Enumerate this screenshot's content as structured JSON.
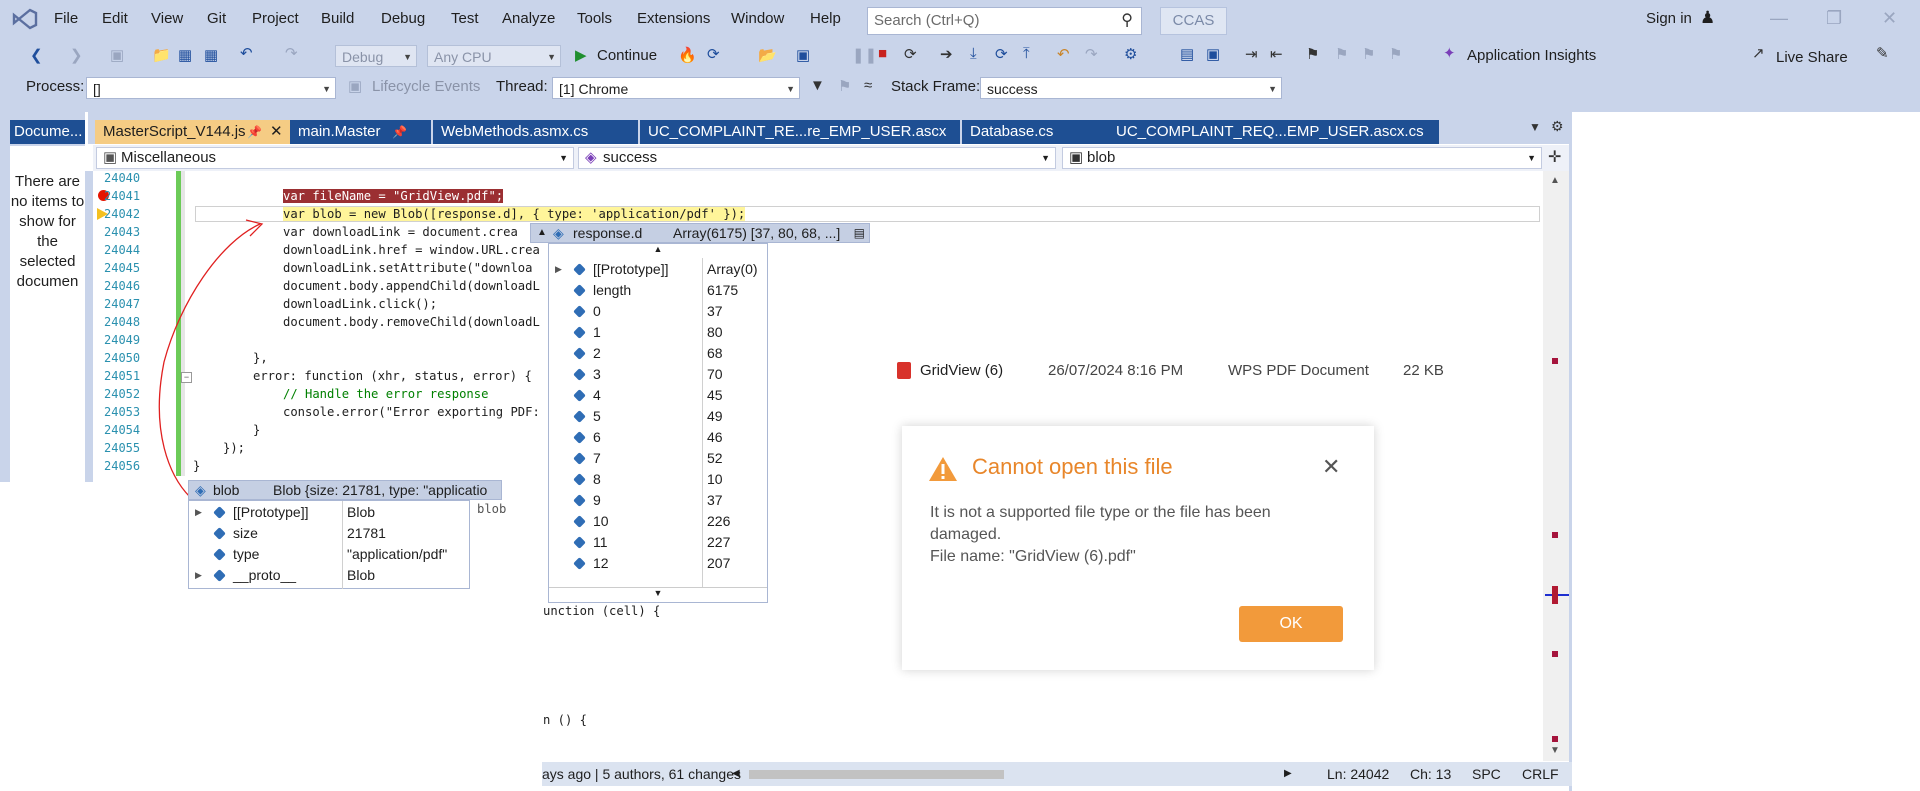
{
  "menu": {
    "items": [
      "File",
      "Edit",
      "View",
      "Git",
      "Project",
      "Build",
      "Debug",
      "Test",
      "Analyze",
      "Tools",
      "Extensions",
      "Window",
      "Help"
    ],
    "search_placeholder": "Search (Ctrl+Q)",
    "solution_name": "CCAS",
    "sign_in": "Sign in"
  },
  "toolbar": {
    "config": "Debug",
    "platform": "Any CPU",
    "continue_label": "Continue",
    "app_insights": "Application Insights",
    "live_share": "Live Share"
  },
  "debug_location": {
    "process_label": "Process:",
    "process_value": "[]",
    "lifecycle_label": "Lifecycle Events",
    "thread_label": "Thread:",
    "thread_value": "[1] Chrome",
    "stack_frame_label": "Stack Frame:",
    "stack_frame_value": "success"
  },
  "doc_panel": {
    "title": "Docume...",
    "empty_message": "There are no items to show for the selected documen"
  },
  "tabs": [
    {
      "label": "MasterScript_V144.js",
      "active": true
    },
    {
      "label": "main.Master",
      "active": false
    },
    {
      "label": "WebMethods.asmx.cs",
      "active": false
    },
    {
      "label": "UC_COMPLAINT_RE...re_EMP_USER.ascx",
      "active": false
    },
    {
      "label": "Database.cs",
      "active": false
    },
    {
      "label": "UC_COMPLAINT_REQ...EMP_USER.ascx.cs",
      "active": false
    }
  ],
  "navbar": {
    "project": "Miscellaneous",
    "scope": "success",
    "member": "blob"
  },
  "code_lines": [
    {
      "n": "24040",
      "text": ""
    },
    {
      "n": "24041",
      "text": "var fileName = \"GridView.pdf\";"
    },
    {
      "n": "24042",
      "text": "var blob = new Blob([response.d], { type: 'application/pdf' });"
    },
    {
      "n": "24043",
      "text": "var downloadLink = document.crea"
    },
    {
      "n": "24044",
      "text": "downloadLink.href = window.URL.crea"
    },
    {
      "n": "24045",
      "text": "downloadLink.setAttribute(\"downloa"
    },
    {
      "n": "24046",
      "text": "document.body.appendChild(downloadL"
    },
    {
      "n": "24047",
      "text": "downloadLink.click();"
    },
    {
      "n": "24048",
      "text": "document.body.removeChild(downloadL"
    },
    {
      "n": "24049",
      "text": ""
    },
    {
      "n": "24050",
      "text": "},"
    },
    {
      "n": "24051",
      "text": "error: function (xhr, status, error) {"
    },
    {
      "n": "24052",
      "text": "// Handle the error response"
    },
    {
      "n": "24053",
      "text": "console.error(\"Error exporting PDF:"
    },
    {
      "n": "24054",
      "text": "}"
    },
    {
      "n": "24055",
      "text": "});"
    },
    {
      "n": "24056",
      "text": "}"
    }
  ],
  "code_fragments": {
    "blob_trail": "blob",
    "function_cell": "unction (cell) {",
    "function_empty": "n () {"
  },
  "datatip_response": {
    "name": "response.d",
    "value": "Array(6175) [37, 80, 68, ...]",
    "rows": [
      {
        "key": "[[Prototype]]",
        "val": "Array(0)",
        "expandable": true
      },
      {
        "key": "length",
        "val": "6175",
        "expandable": false
      },
      {
        "key": "0",
        "val": "37",
        "expandable": false
      },
      {
        "key": "1",
        "val": "80",
        "expandable": false
      },
      {
        "key": "2",
        "val": "68",
        "expandable": false
      },
      {
        "key": "3",
        "val": "70",
        "expandable": false
      },
      {
        "key": "4",
        "val": "45",
        "expandable": false
      },
      {
        "key": "5",
        "val": "49",
        "expandable": false
      },
      {
        "key": "6",
        "val": "46",
        "expandable": false
      },
      {
        "key": "7",
        "val": "52",
        "expandable": false
      },
      {
        "key": "8",
        "val": "10",
        "expandable": false
      },
      {
        "key": "9",
        "val": "37",
        "expandable": false
      },
      {
        "key": "10",
        "val": "226",
        "expandable": false
      },
      {
        "key": "11",
        "val": "227",
        "expandable": false
      },
      {
        "key": "12",
        "val": "207",
        "expandable": false
      }
    ]
  },
  "datatip_blob": {
    "name": "blob",
    "value": "Blob {size: 21781, type: \"applicatio",
    "rows": [
      {
        "key": "[[Prototype]]",
        "val": "Blob",
        "expandable": true
      },
      {
        "key": "size",
        "val": "21781",
        "expandable": false
      },
      {
        "key": "type",
        "val": "\"application/pdf\"",
        "expandable": false
      },
      {
        "key": "__proto__",
        "val": "Blob",
        "expandable": true
      }
    ]
  },
  "file_entry": {
    "name": "GridView (6)",
    "date": "26/07/2024 8:16 PM",
    "type": "WPS PDF Document",
    "size": "22 KB"
  },
  "dialog": {
    "title": "Cannot open this file",
    "message": "It is not a supported file type or the file has been damaged.",
    "file_line": "File name: \"GridView (6).pdf\"",
    "ok": "OK",
    "accent": "#f29a3b"
  },
  "status_bar": {
    "blame": "ays ago | 5 authors, 61 changes",
    "line": "Ln: 24042",
    "col": "Ch: 13",
    "spacing": "SPC",
    "eol": "CRLF"
  }
}
